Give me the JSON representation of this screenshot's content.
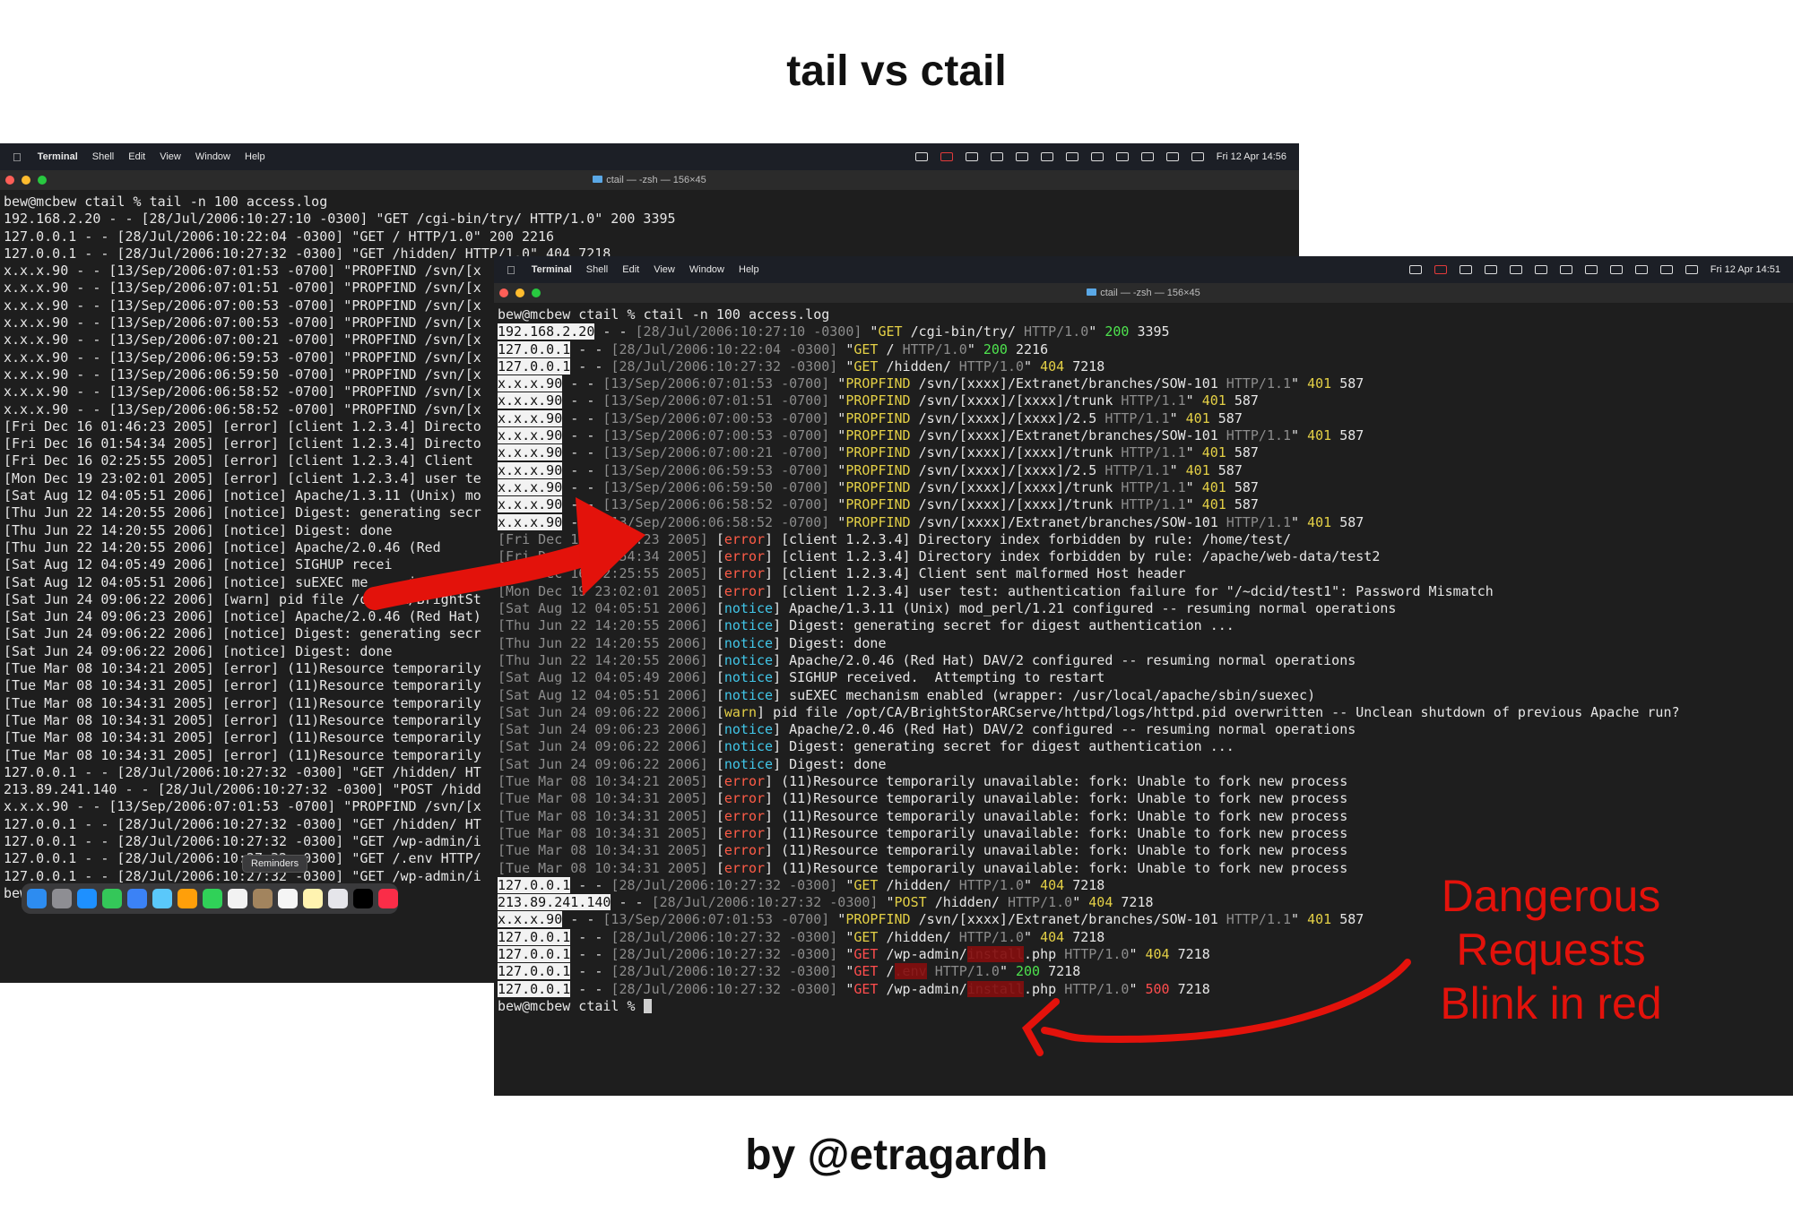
{
  "title": "tail vs ctail",
  "byline": "by @etragardh",
  "annotation": [
    "Dangerous",
    "Requests",
    "Blink in red"
  ],
  "colors": {
    "annotation": "#e3120b",
    "error": "#ff5c47",
    "notice": "#41c6e8",
    "ok": "#4ee24e",
    "warn": "#e4d046"
  },
  "menubar": {
    "app": "Terminal",
    "items": [
      "Shell",
      "Edit",
      "View",
      "Window",
      "Help"
    ],
    "status_icons": [
      "screen-record-icon",
      "link-icon",
      "cloud-icon",
      "clipboard-icon",
      "display-icon",
      "screen-share-icon",
      "keyboard-icon",
      "play-icon",
      "keyboard-icon",
      "battery-icon",
      "wifi-icon",
      "search-icon",
      "control-center-icon"
    ]
  },
  "tail_window": {
    "clock": "Fri 12 Apr 14:56",
    "title": "ctail — -zsh — 156×45",
    "prompt": "bew@mcbew ctail % ",
    "command": "tail -n 100 access.log",
    "lines": [
      "192.168.2.20 - - [28/Jul/2006:10:27:10 -0300] \"GET /cgi-bin/try/ HTTP/1.0\" 200 3395",
      "127.0.0.1 - - [28/Jul/2006:10:22:04 -0300] \"GET / HTTP/1.0\" 200 2216",
      "127.0.0.1 - - [28/Jul/2006:10:27:32 -0300] \"GET /hidden/ HTTP/1.0\" 404 7218",
      "x.x.x.90 - - [13/Sep/2006:07:01:53 -0700] \"PROPFIND /svn/[x",
      "x.x.x.90 - - [13/Sep/2006:07:01:51 -0700] \"PROPFIND /svn/[x",
      "x.x.x.90 - - [13/Sep/2006:07:00:53 -0700] \"PROPFIND /svn/[x",
      "x.x.x.90 - - [13/Sep/2006:07:00:53 -0700] \"PROPFIND /svn/[x",
      "x.x.x.90 - - [13/Sep/2006:07:00:21 -0700] \"PROPFIND /svn/[x",
      "x.x.x.90 - - [13/Sep/2006:06:59:53 -0700] \"PROPFIND /svn/[x",
      "x.x.x.90 - - [13/Sep/2006:06:59:50 -0700] \"PROPFIND /svn/[x",
      "x.x.x.90 - - [13/Sep/2006:06:58:52 -0700] \"PROPFIND /svn/[x",
      "x.x.x.90 - - [13/Sep/2006:06:58:52 -0700] \"PROPFIND /svn/[x",
      "[Fri Dec 16 01:46:23 2005] [error] [client 1.2.3.4] Directo",
      "[Fri Dec 16 01:54:34 2005] [error] [client 1.2.3.4] Directo",
      "[Fri Dec 16 02:25:55 2005] [error] [client 1.2.3.4] Client",
      "[Mon Dec 19 23:02:01 2005] [error] [client 1.2.3.4] user te",
      "[Sat Aug 12 04:05:51 2006] [notice] Apache/1.3.11 (Unix) mo",
      "[Thu Jun 22 14:20:55 2006] [notice] Digest: generating secr",
      "[Thu Jun 22 14:20:55 2006] [notice] Digest: done",
      "[Thu Jun 22 14:20:55 2006] [notice] Apache/2.0.46 (Red",
      "[Sat Aug 12 04:05:49 2006] [notice] SIGHUP recei",
      "[Sat Aug 12 04:05:51 2006] [notice] suEXEC me     ism enable",
      "[Sat Jun 24 09:06:22 2006] [warn] pid file /opt/CA/BrightSt",
      "[Sat Jun 24 09:06:23 2006] [notice] Apache/2.0.46 (Red Hat)",
      "[Sat Jun 24 09:06:22 2006] [notice] Digest: generating secr",
      "[Sat Jun 24 09:06:22 2006] [notice] Digest: done",
      "[Tue Mar 08 10:34:21 2005] [error] (11)Resource temporarily",
      "[Tue Mar 08 10:34:31 2005] [error] (11)Resource temporarily",
      "[Tue Mar 08 10:34:31 2005] [error] (11)Resource temporarily",
      "[Tue Mar 08 10:34:31 2005] [error] (11)Resource temporarily",
      "[Tue Mar 08 10:34:31 2005] [error] (11)Resource temporarily",
      "[Tue Mar 08 10:34:31 2005] [error] (11)Resource temporarily",
      "127.0.0.1 - - [28/Jul/2006:10:27:32 -0300] \"GET /hidden/ HT",
      "213.89.241.140 - - [28/Jul/2006:10:27:32 -0300] \"POST /hidd",
      "x.x.x.90 - - [13/Sep/2006:07:01:53 -0700] \"PROPFIND /svn/[x",
      "127.0.0.1 - - [28/Jul/2006:10:27:32 -0300] \"GET /hidden/ HT",
      "127.0.0.1 - - [28/Jul/2006:10:27:32 -0300] \"GET /wp-admin/i",
      "127.0.0.1 - - [28/Jul/2006:10:27:32 -0300] \"GET /.env HTTP/",
      "127.0.0.1 - - [28/Jul/2006:10:27:32 -0300] \"GET /wp-admin/i"
    ],
    "tooltip": "Reminders"
  },
  "ctail_window": {
    "clock": "Fri 12 Apr 14:51",
    "title": "ctail — -zsh — 156×45",
    "prompt": "bew@mcbew ctail % ",
    "command": "ctail -n 100 access.log",
    "lines": [
      {
        "t": "access",
        "ip": "192.168.2.20",
        "date": "[28/Jul/2006:10:27:10 -0300]",
        "verb": "GET",
        "path": "/cgi-bin/try/",
        "proto": "HTTP/1.0",
        "status": "200",
        "size": "3395"
      },
      {
        "t": "access",
        "ip": "127.0.0.1",
        "date": "[28/Jul/2006:10:22:04 -0300]",
        "verb": "GET",
        "path": "/",
        "proto": "HTTP/1.0",
        "status": "200",
        "size": "2216"
      },
      {
        "t": "access",
        "ip": "127.0.0.1",
        "date": "[28/Jul/2006:10:27:32 -0300]",
        "verb": "GET",
        "path": "/hidden/",
        "proto": "HTTP/1.0",
        "status": "404",
        "size": "7218"
      },
      {
        "t": "access",
        "ip": "x.x.x.90",
        "date": "[13/Sep/2006:07:01:53 -0700]",
        "verb": "PROPFIND",
        "path": "/svn/[xxxx]/Extranet/branches/SOW-101",
        "proto": "HTTP/1.1",
        "status": "401",
        "size": "587"
      },
      {
        "t": "access",
        "ip": "x.x.x.90",
        "date": "[13/Sep/2006:07:01:51 -0700]",
        "verb": "PROPFIND",
        "path": "/svn/[xxxx]/[xxxx]/trunk",
        "proto": "HTTP/1.1",
        "status": "401",
        "size": "587"
      },
      {
        "t": "access",
        "ip": "x.x.x.90",
        "date": "[13/Sep/2006:07:00:53 -0700]",
        "verb": "PROPFIND",
        "path": "/svn/[xxxx]/[xxxx]/2.5",
        "proto": "HTTP/1.1",
        "status": "401",
        "size": "587"
      },
      {
        "t": "access",
        "ip": "x.x.x.90",
        "date": "[13/Sep/2006:07:00:53 -0700]",
        "verb": "PROPFIND",
        "path": "/svn/[xxxx]/Extranet/branches/SOW-101",
        "proto": "HTTP/1.1",
        "status": "401",
        "size": "587"
      },
      {
        "t": "access",
        "ip": "x.x.x.90",
        "date": "[13/Sep/2006:07:00:21 -0700]",
        "verb": "PROPFIND",
        "path": "/svn/[xxxx]/[xxxx]/trunk",
        "proto": "HTTP/1.1",
        "status": "401",
        "size": "587"
      },
      {
        "t": "access",
        "ip": "x.x.x.90",
        "date": "[13/Sep/2006:06:59:53 -0700]",
        "verb": "PROPFIND",
        "path": "/svn/[xxxx]/[xxxx]/2.5",
        "proto": "HTTP/1.1",
        "status": "401",
        "size": "587"
      },
      {
        "t": "access",
        "ip": "x.x.x.90",
        "date": "[13/Sep/2006:06:59:50 -0700]",
        "verb": "PROPFIND",
        "path": "/svn/[xxxx]/[xxxx]/trunk",
        "proto": "HTTP/1.1",
        "status": "401",
        "size": "587"
      },
      {
        "t": "access",
        "ip": "x.x.x.90",
        "date": "[13/Sep/2006:06:58:52 -0700]",
        "verb": "PROPFIND",
        "path": "/svn/[xxxx]/[xxxx]/trunk",
        "proto": "HTTP/1.1",
        "status": "401",
        "size": "587"
      },
      {
        "t": "access",
        "ip": "x.x.x.90",
        "date": "[13/Sep/2006:06:58:52 -0700]",
        "verb": "PROPFIND",
        "path": "/svn/[xxxx]/Extranet/branches/SOW-101",
        "proto": "HTTP/1.1",
        "status": "401",
        "size": "587"
      },
      {
        "t": "error",
        "date": "[Fri Dec 16 01:46:23 2005]",
        "level": "error",
        "msg": "[client 1.2.3.4] Directory index forbidden by rule: /home/test/"
      },
      {
        "t": "error",
        "date": "[Fri Dec 16 01:54:34 2005]",
        "level": "error",
        "msg": "[client 1.2.3.4] Directory index forbidden by rule: /apache/web-data/test2"
      },
      {
        "t": "error",
        "date": "[Fri Dec 16 02:25:55 2005]",
        "level": "error",
        "msg": "[client 1.2.3.4] Client sent malformed Host header"
      },
      {
        "t": "error",
        "date": "[Mon Dec 19 23:02:01 2005]",
        "level": "error",
        "msg": "[client 1.2.3.4] user test: authentication failure for \"/~dcid/test1\": Password Mismatch"
      },
      {
        "t": "error",
        "date": "[Sat Aug 12 04:05:51 2006]",
        "level": "notice",
        "msg": "Apache/1.3.11 (Unix) mod_perl/1.21 configured -- resuming normal operations"
      },
      {
        "t": "error",
        "date": "[Thu Jun 22 14:20:55 2006]",
        "level": "notice",
        "msg": "Digest: generating secret for digest authentication ..."
      },
      {
        "t": "error",
        "date": "[Thu Jun 22 14:20:55 2006]",
        "level": "notice",
        "msg": "Digest: done"
      },
      {
        "t": "error",
        "date": "[Thu Jun 22 14:20:55 2006]",
        "level": "notice",
        "msg": "Apache/2.0.46 (Red Hat) DAV/2 configured -- resuming normal operations"
      },
      {
        "t": "error",
        "date": "[Sat Aug 12 04:05:49 2006]",
        "level": "notice",
        "msg": "SIGHUP received.  Attempting to restart"
      },
      {
        "t": "error",
        "date": "[Sat Aug 12 04:05:51 2006]",
        "level": "notice",
        "msg": "suEXEC mechanism enabled (wrapper: /usr/local/apache/sbin/suexec)"
      },
      {
        "t": "error",
        "date": "[Sat Jun 24 09:06:22 2006]",
        "level": "warn",
        "msg": "pid file /opt/CA/BrightStorARCserve/httpd/logs/httpd.pid overwritten -- Unclean shutdown of previous Apache run?"
      },
      {
        "t": "error",
        "date": "[Sat Jun 24 09:06:23 2006]",
        "level": "notice",
        "msg": "Apache/2.0.46 (Red Hat) DAV/2 configured -- resuming normal operations"
      },
      {
        "t": "error",
        "date": "[Sat Jun 24 09:06:22 2006]",
        "level": "notice",
        "msg": "Digest: generating secret for digest authentication ..."
      },
      {
        "t": "error",
        "date": "[Sat Jun 24 09:06:22 2006]",
        "level": "notice",
        "msg": "Digest: done"
      },
      {
        "t": "error",
        "date": "[Tue Mar 08 10:34:21 2005]",
        "level": "error",
        "msg": "(11)Resource temporarily unavailable: fork: Unable to fork new process"
      },
      {
        "t": "error",
        "date": "[Tue Mar 08 10:34:31 2005]",
        "level": "error",
        "msg": "(11)Resource temporarily unavailable: fork: Unable to fork new process"
      },
      {
        "t": "error",
        "date": "[Tue Mar 08 10:34:31 2005]",
        "level": "error",
        "msg": "(11)Resource temporarily unavailable: fork: Unable to fork new process"
      },
      {
        "t": "error",
        "date": "[Tue Mar 08 10:34:31 2005]",
        "level": "error",
        "msg": "(11)Resource temporarily unavailable: fork: Unable to fork new process"
      },
      {
        "t": "error",
        "date": "[Tue Mar 08 10:34:31 2005]",
        "level": "error",
        "msg": "(11)Resource temporarily unavailable: fork: Unable to fork new process"
      },
      {
        "t": "error",
        "date": "[Tue Mar 08 10:34:31 2005]",
        "level": "error",
        "msg": "(11)Resource temporarily unavailable: fork: Unable to fork new process"
      },
      {
        "t": "access",
        "ip": "127.0.0.1",
        "date": "[28/Jul/2006:10:27:32 -0300]",
        "verb": "GET",
        "path": "/hidden/",
        "proto": "HTTP/1.0",
        "status": "404",
        "size": "7218"
      },
      {
        "t": "access",
        "ip": "213.89.241.140",
        "date": "[28/Jul/2006:10:27:32 -0300]",
        "verb": "POST",
        "path": "/hidden/",
        "proto": "HTTP/1.0",
        "status": "404",
        "size": "7218"
      },
      {
        "t": "access",
        "ip": "x.x.x.90",
        "date": "[13/Sep/2006:07:01:53 -0700]",
        "verb": "PROPFIND",
        "path": "/svn/[xxxx]/Extranet/branches/SOW-101",
        "proto": "HTTP/1.1",
        "status": "401",
        "size": "587"
      },
      {
        "t": "access",
        "ip": "127.0.0.1",
        "date": "[28/Jul/2006:10:27:32 -0300]",
        "verb": "GET",
        "path": "/hidden/",
        "proto": "HTTP/1.0",
        "status": "404",
        "size": "7218"
      },
      {
        "t": "access",
        "ip": "127.0.0.1",
        "date": "[28/Jul/2006:10:27:32 -0300]",
        "verb": "GET",
        "path": [
          "/wp-admin/",
          "install",
          ".php"
        ],
        "proto": "HTTP/1.0",
        "status": "404",
        "size": "7218",
        "danger": true
      },
      {
        "t": "access",
        "ip": "127.0.0.1",
        "date": "[28/Jul/2006:10:27:32 -0300]",
        "verb": "GET",
        "path": [
          "/",
          ".env",
          ""
        ],
        "proto": "HTTP/1.0",
        "status": "200",
        "size": "7218",
        "danger": true
      },
      {
        "t": "access",
        "ip": "127.0.0.1",
        "date": "[28/Jul/2006:10:27:32 -0300]",
        "verb": "GET",
        "path": [
          "/wp-admin/",
          "install",
          ".php"
        ],
        "proto": "HTTP/1.0",
        "status": "500",
        "size": "7218",
        "danger": true
      }
    ]
  }
}
